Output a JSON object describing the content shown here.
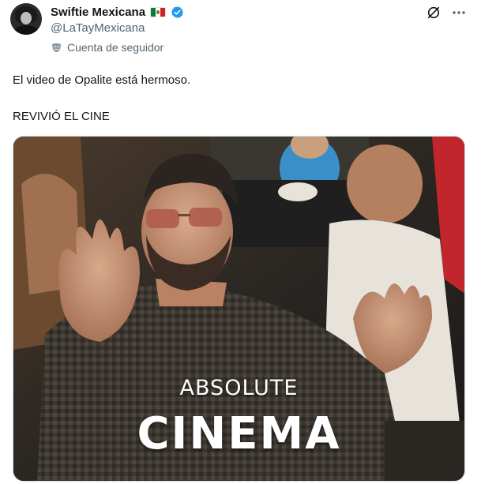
{
  "author": {
    "display_name": "Swiftie Mexicana",
    "handle": "@LaTayMexicana",
    "label": "Cuenta de seguidor",
    "flag_icon": "mexico-flag-icon",
    "verified_icon": "verified-badge-icon",
    "verified_color": "#1d9bf0"
  },
  "actions": {
    "grok_icon": "grok-icon",
    "more_icon": "more-icon"
  },
  "tweet": {
    "line1": "El video de Opalite está hermoso.",
    "line2": "REVIVIÓ EL CINE"
  },
  "media": {
    "caption_top": "ABSOLUTE",
    "caption_bottom": "CINEMA"
  }
}
